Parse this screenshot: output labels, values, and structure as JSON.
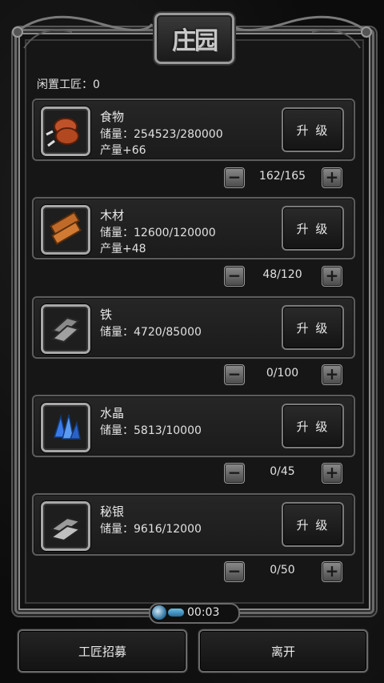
{
  "screen": {
    "title": "庄园",
    "idle_label": "闲置工匠：0"
  },
  "resources": [
    {
      "name": "食物",
      "storage": "储量：254523/280000",
      "production": "产量+66",
      "upgrade_label": "升 级",
      "workers": "162/165",
      "icon": "roasted-meat-icon"
    },
    {
      "name": "木材",
      "storage": "储量：12600/120000",
      "production": "产量+48",
      "upgrade_label": "升 级",
      "workers": "48/120",
      "icon": "wood-planks-icon"
    },
    {
      "name": "铁",
      "storage": "储量：4720/85000",
      "production": "",
      "upgrade_label": "升 级",
      "workers": "0/100",
      "icon": "iron-ingot-icon"
    },
    {
      "name": "水晶",
      "storage": "储量：5813/10000",
      "production": "",
      "upgrade_label": "升 级",
      "workers": "0/45",
      "icon": "crystal-icon"
    },
    {
      "name": "秘银",
      "storage": "储量：9616/12000",
      "production": "",
      "upgrade_label": "升 级",
      "workers": "0/50",
      "icon": "mithril-ingot-icon"
    }
  ],
  "stepper": {
    "minus_symbol": "−",
    "plus_symbol": "+"
  },
  "timer": {
    "time": "00:03"
  },
  "footer": {
    "recruit_label": "工匠招募",
    "leave_label": "离开"
  },
  "colors": {
    "frame": "#8a8a8a",
    "card_bg": "#222222",
    "text": "#e0e0e0",
    "timer_accent": "#3a7ca8"
  }
}
